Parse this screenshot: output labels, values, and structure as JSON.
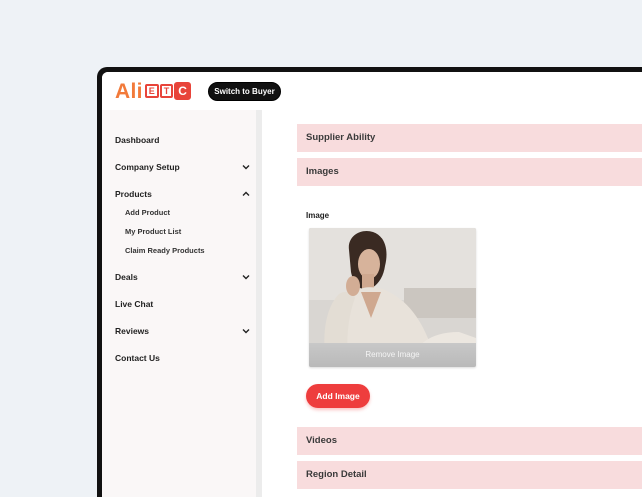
{
  "header": {
    "logo_text": "Ali",
    "logo_box_letters": [
      "E",
      "T",
      "C"
    ],
    "switch_label": "Switch to Buyer"
  },
  "sidebar": {
    "items": [
      {
        "label": "Dashboard",
        "chevron": "none"
      },
      {
        "label": "Company Setup",
        "chevron": "chevron-down-icon"
      },
      {
        "label": "Products",
        "chevron": "chevron-up-icon"
      },
      {
        "label": "Deals",
        "chevron": "chevron-down-icon"
      },
      {
        "label": "Live Chat",
        "chevron": "none"
      },
      {
        "label": "Reviews",
        "chevron": "chevron-down-icon"
      },
      {
        "label": "Contact Us",
        "chevron": "none"
      }
    ],
    "product_subitems": [
      {
        "label": "Add Product"
      },
      {
        "label": "My Product List"
      },
      {
        "label": "Claim Ready Products"
      }
    ]
  },
  "main": {
    "sections": [
      {
        "label": "Supplier Ability"
      },
      {
        "label": "Images"
      },
      {
        "label": "Videos"
      },
      {
        "label": "Region Detail"
      }
    ],
    "image_label": "Image",
    "remove_image_label": "Remove Image",
    "add_image_label": "Add Image"
  },
  "colors": {
    "accent": "#ee3d3d",
    "logo_orange": "#f27a3a",
    "section_bg": "#f8dcdd",
    "page_bg": "#eef2f6"
  }
}
